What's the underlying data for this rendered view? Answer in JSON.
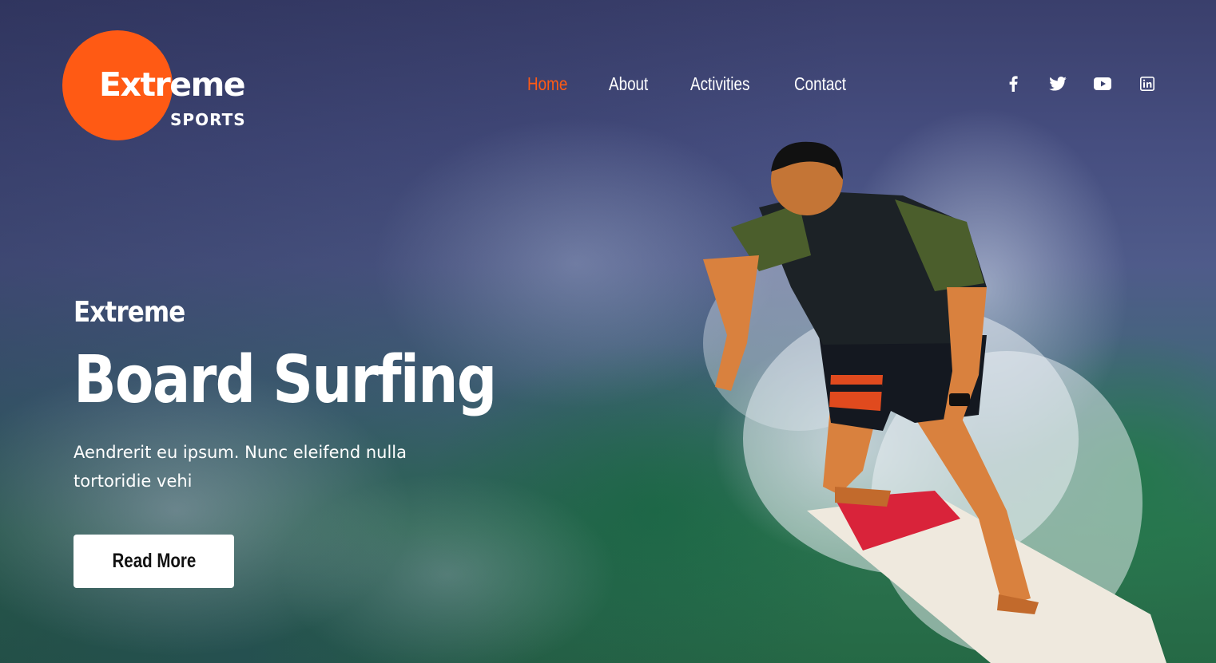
{
  "brand": {
    "name": "Extreme",
    "tagline": "SPORTS",
    "accent_color": "#ff5a14"
  },
  "nav": {
    "items": [
      {
        "label": "Home",
        "active": true
      },
      {
        "label": "About",
        "active": false
      },
      {
        "label": "Activities",
        "active": false
      },
      {
        "label": "Contact",
        "active": false
      }
    ]
  },
  "social": {
    "icons": [
      "facebook-icon",
      "twitter-icon",
      "youtube-icon",
      "linkedin-icon"
    ]
  },
  "hero": {
    "eyebrow": "Extreme",
    "headline": "Board Surfing",
    "description": "Aendrerit eu ipsum. Nunc eleifend nulla tortoridie vehi",
    "cta_label": "Read More",
    "background": "surfer riding a wave"
  }
}
